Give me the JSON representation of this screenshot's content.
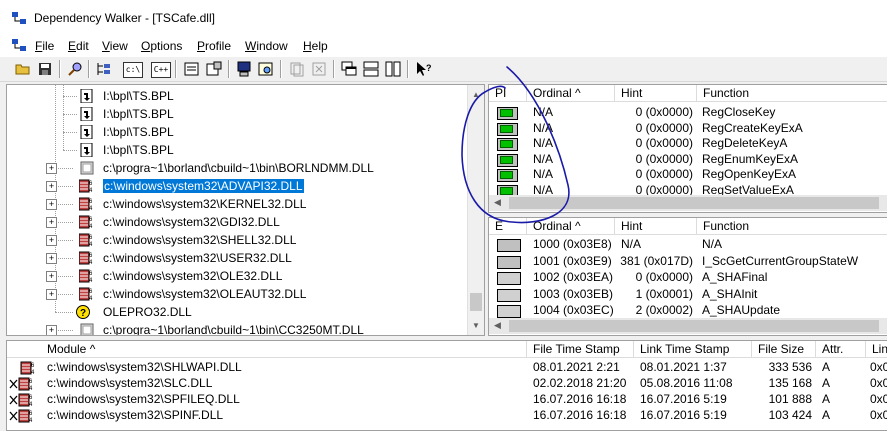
{
  "window": {
    "title": "Dependency Walker - [TSCafe.dll]"
  },
  "menu": [
    {
      "pre": "",
      "key": "F",
      "post": "ile"
    },
    {
      "pre": "",
      "key": "E",
      "post": "dit"
    },
    {
      "pre": "",
      "key": "V",
      "post": "iew"
    },
    {
      "pre": "",
      "key": "O",
      "post": "ptions"
    },
    {
      "pre": "",
      "key": "P",
      "post": "rofile"
    },
    {
      "pre": "",
      "key": "W",
      "post": "indow"
    },
    {
      "pre": "",
      "key": "H",
      "post": "elp"
    }
  ],
  "toolbar": {
    "text_buttons": [
      "c:\\",
      "C++"
    ]
  },
  "tree": {
    "rows": [
      {
        "label": "I:\\bpl\\TS.BPL"
      },
      {
        "label": "I:\\bpl\\TS.BPL"
      },
      {
        "label": "I:\\bpl\\TS.BPL"
      },
      {
        "label": "I:\\bpl\\TS.BPL"
      },
      {
        "label": "c:\\progra~1\\borland\\cbuild~1\\bin\\BORLNDMM.DLL"
      },
      {
        "label": "c:\\windows\\system32\\ADVAPI32.DLL"
      },
      {
        "label": "c:\\windows\\system32\\KERNEL32.DLL"
      },
      {
        "label": "c:\\windows\\system32\\GDI32.DLL"
      },
      {
        "label": "c:\\windows\\system32\\SHELL32.DLL"
      },
      {
        "label": "c:\\windows\\system32\\USER32.DLL"
      },
      {
        "label": "c:\\windows\\system32\\OLE32.DLL"
      },
      {
        "label": "c:\\windows\\system32\\OLEAUT32.DLL"
      },
      {
        "label": "OLEPRO32.DLL"
      },
      {
        "label": "c:\\progra~1\\borland\\cbuild~1\\bin\\CC3250MT.DLL"
      }
    ]
  },
  "parent_imports": {
    "headers": [
      "PI",
      "Ordinal ^",
      "Hint",
      "Function"
    ],
    "rows": [
      {
        "ordinal": "N/A",
        "hint": "0 (0x0000)",
        "function": "RegCloseKey"
      },
      {
        "ordinal": "N/A",
        "hint": "0 (0x0000)",
        "function": "RegCreateKeyExA"
      },
      {
        "ordinal": "N/A",
        "hint": "0 (0x0000)",
        "function": "RegDeleteKeyA"
      },
      {
        "ordinal": "N/A",
        "hint": "0 (0x0000)",
        "function": "RegEnumKeyExA"
      },
      {
        "ordinal": "N/A",
        "hint": "0 (0x0000)",
        "function": "RegOpenKeyExA"
      },
      {
        "ordinal": "N/A",
        "hint": "0 (0x0000)",
        "function": "RegSetValueExA"
      }
    ]
  },
  "exports": {
    "headers": [
      "E",
      "Ordinal ^",
      "Hint",
      "Function"
    ],
    "rows": [
      {
        "ordinal": "1000 (0x03E8)",
        "hint": "N/A",
        "function": "N/A"
      },
      {
        "ordinal": "1001 (0x03E9)",
        "hint": "381 (0x017D)",
        "function": "I_ScGetCurrentGroupStateW"
      },
      {
        "ordinal": "1002 (0x03EA)",
        "hint": "0 (0x0000)",
        "function": "A_SHAFinal"
      },
      {
        "ordinal": "1003 (0x03EB)",
        "hint": "1 (0x0001)",
        "function": "A_SHAInit"
      },
      {
        "ordinal": "1004 (0x03EC)",
        "hint": "2 (0x0002)",
        "function": "A_SHAUpdate"
      }
    ]
  },
  "modules": {
    "headers": [
      "Module ^",
      "File Time Stamp",
      "Link Time Stamp",
      "File Size",
      "Attr.",
      "Lin"
    ],
    "rows": [
      {
        "module": "c:\\windows\\system32\\SHLWAPI.DLL",
        "file_ts": "08.01.2021  2:21",
        "link_ts": "08.01.2021  1:37",
        "size": "333 536",
        "attr": "A",
        "lin": "0x0"
      },
      {
        "module": "c:\\windows\\system32\\SLC.DLL",
        "file_ts": "02.02.2018 21:20",
        "link_ts": "05.08.2016 11:08",
        "size": "135 168",
        "attr": "A",
        "lin": "0x0"
      },
      {
        "module": "c:\\windows\\system32\\SPFILEQ.DLL",
        "file_ts": "16.07.2016 16:18",
        "link_ts": "16.07.2016  5:19",
        "size": "101 888",
        "attr": "A",
        "lin": "0x0"
      },
      {
        "module": "c:\\windows\\system32\\SPINF.DLL",
        "file_ts": "16.07.2016 16:18",
        "link_ts": "16.07.2016  5:19",
        "size": "103 424",
        "attr": "A",
        "lin": "0x0"
      }
    ]
  },
  "colors": {
    "selection": "#0078d7",
    "annotation": "#1a1aa8",
    "import_ok": "#00c000"
  }
}
